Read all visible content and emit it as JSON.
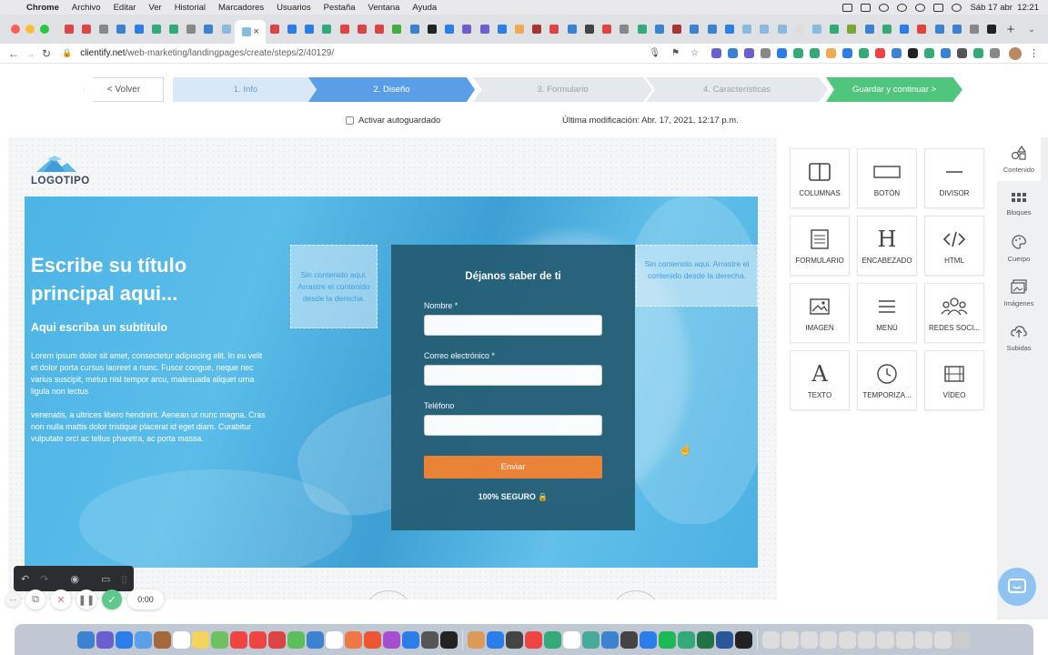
{
  "menubar": {
    "app": "Chrome",
    "items": [
      "Archivo",
      "Editar",
      "Ver",
      "Historial",
      "Marcadores",
      "Usuarios",
      "Pestaña",
      "Ventana",
      "Ayuda"
    ],
    "clock": "Sáb 17 abr  12:21"
  },
  "browser": {
    "host": "clientify.net",
    "path": "/web-marketing/landingpages/create/steps/2/40129/"
  },
  "steps": {
    "back": "< Volver",
    "items": [
      "1. Info",
      "2. Diseño",
      "3. Formulario",
      "4. Características"
    ],
    "save": "Guardar y continuar >"
  },
  "autosave_label": "Activar autoguardado",
  "last_modified": "Última modificación: Abr. 17, 2021, 12:17 p.m.",
  "landing": {
    "logo": "LOGOTIPO",
    "title": "Escribe su título principal aqui...",
    "subtitle": "Aqui escriba un subtitulo",
    "paragraph1": "Lorem ipsum dolor sit amet, consectetur adipiscing elit. In eu velit et dolor porta cursus laoreet a nunc. Fusce congue, neque nec varius suscipit, metus nisl tempor arcu, malesuada aliquet urna ligula non lectus",
    "paragraph2": "venenatis, a ultrices libero hendrerit. Aenean ut nunc magna. Cras non nulla mattis dolor tristique placerat id eget diam. Curabitur vulputate orci ac tellus pharetra, ac porta massa.",
    "drop_left": "Sin contenido aqui. Arrastre el contenido desde la derecha.",
    "drop_right": "Sin contenido aqui. Arrastre el contenido desde la derecha.",
    "form": {
      "title": "Déjanos saber de ti",
      "name_label": "Nombre *",
      "email_label": "Correo electrónico *",
      "phone_label": "Teléfono",
      "submit": "Enviar",
      "secure": "100% SEGURO 🔒"
    }
  },
  "widgets": [
    {
      "label": "COLUMNAS",
      "icon": "columns-icon"
    },
    {
      "label": "BOTÓN",
      "icon": "button-icon"
    },
    {
      "label": "DIVISOR",
      "icon": "divider-icon"
    },
    {
      "label": "FORMULARIO",
      "icon": "form-icon"
    },
    {
      "label": "ENCABEZADO",
      "icon": "heading-icon"
    },
    {
      "label": "HTML",
      "icon": "code-icon"
    },
    {
      "label": "IMAGEN",
      "icon": "image-icon"
    },
    {
      "label": "MENÚ",
      "icon": "menu-icon"
    },
    {
      "label": "REDES SOCI...",
      "icon": "social-icon"
    },
    {
      "label": "TEXTO",
      "icon": "text-icon"
    },
    {
      "label": "TEMPORIZA...",
      "icon": "timer-icon"
    },
    {
      "label": "VÍDEO",
      "icon": "video-icon"
    }
  ],
  "sidebar": [
    {
      "label": "Contenido",
      "icon": "shapes-icon"
    },
    {
      "label": "Bloques",
      "icon": "blocks-icon"
    },
    {
      "label": "Cuerpo",
      "icon": "palette-icon"
    },
    {
      "label": "Imágenes",
      "icon": "images-icon"
    },
    {
      "label": "Subidas",
      "icon": "upload-cloud-icon"
    }
  ],
  "recorder": {
    "time": "0:00"
  },
  "colors": {
    "primary_step": "#5b9ee8",
    "save": "#4fc57d",
    "submit": "#ef8130",
    "form_bg": "#255f77",
    "hero": "#4db4e6"
  }
}
